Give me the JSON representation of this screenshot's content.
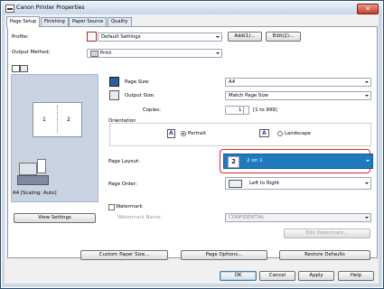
{
  "window": {
    "title": "Canon Printer Properties",
    "close_glyph": "✕"
  },
  "tabs": [
    "Page Setup",
    "Finishing",
    "Paper Source",
    "Quality"
  ],
  "profile": {
    "label": "Profile:",
    "value": "Default Settings",
    "add_button": "Add(1)...",
    "edit_button": "Edit(2)..."
  },
  "output_method": {
    "label": "Output Method:",
    "value": "Print"
  },
  "preview": {
    "page1": "1",
    "page2": "2",
    "scaling_text": "A4 [Scaling: Auto]",
    "view_settings_button": "View Settings"
  },
  "page_size": {
    "label": "Page Size:",
    "value": "A4"
  },
  "output_size": {
    "label": "Output Size:",
    "value": "Match Page Size"
  },
  "copies": {
    "label": "Copies:",
    "value": "1",
    "range": "[1 to 999]"
  },
  "orientation": {
    "label": "Orientation",
    "portrait": "Portrait",
    "landscape": "Landscape",
    "selected": "Portrait"
  },
  "page_layout": {
    "label": "Page Layout:",
    "value": "2 on 1",
    "icon_number": "2"
  },
  "page_order": {
    "label": "Page Order:",
    "value": "Left to Right"
  },
  "watermark": {
    "checkbox_label": "Watermark",
    "name_label": "Watermark Name:",
    "name_value": "CONFIDENTIAL",
    "edit_button": "Edit Watermark..."
  },
  "bottom_buttons": {
    "custom_paper_size": "Custom Paper Size...",
    "page_options": "Page Options...",
    "restore_defaults": "Restore Defaults"
  },
  "dialog_buttons": {
    "ok": "OK",
    "cancel": "Cancel",
    "apply": "Apply",
    "help": "Help"
  },
  "colors": {
    "accent_selection": "#1f7bbd",
    "highlight_border": "#e0282a",
    "preview_bg": "#c9d4e2"
  }
}
